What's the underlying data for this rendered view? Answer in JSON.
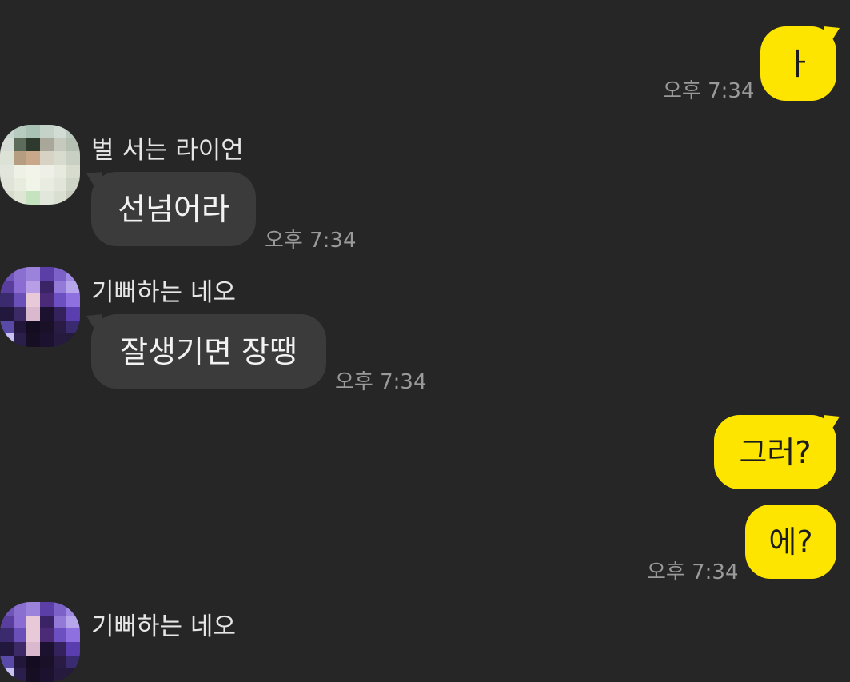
{
  "messages": [
    {
      "side": "me",
      "text": "ㅏ",
      "time": "오후 7:34"
    },
    {
      "side": "them",
      "sender": "벌 서는 라이언",
      "text": "선넘어라",
      "time": "오후 7:34"
    },
    {
      "side": "them",
      "sender": "기뻐하는 네오",
      "text": "잘생기면 장땡",
      "time": "오후 7:34"
    },
    {
      "side": "me",
      "text": "그러?"
    },
    {
      "side": "me",
      "text": "에?",
      "time": "오후 7:34"
    },
    {
      "side": "them",
      "sender": "기뻐하는 네오"
    }
  ],
  "colors": {
    "background": "#262626",
    "my_bubble": "#fee500",
    "their_bubble": "#3b3b3b",
    "timestamp": "#9a9a9a",
    "sender_name": "#e6e6e6"
  }
}
